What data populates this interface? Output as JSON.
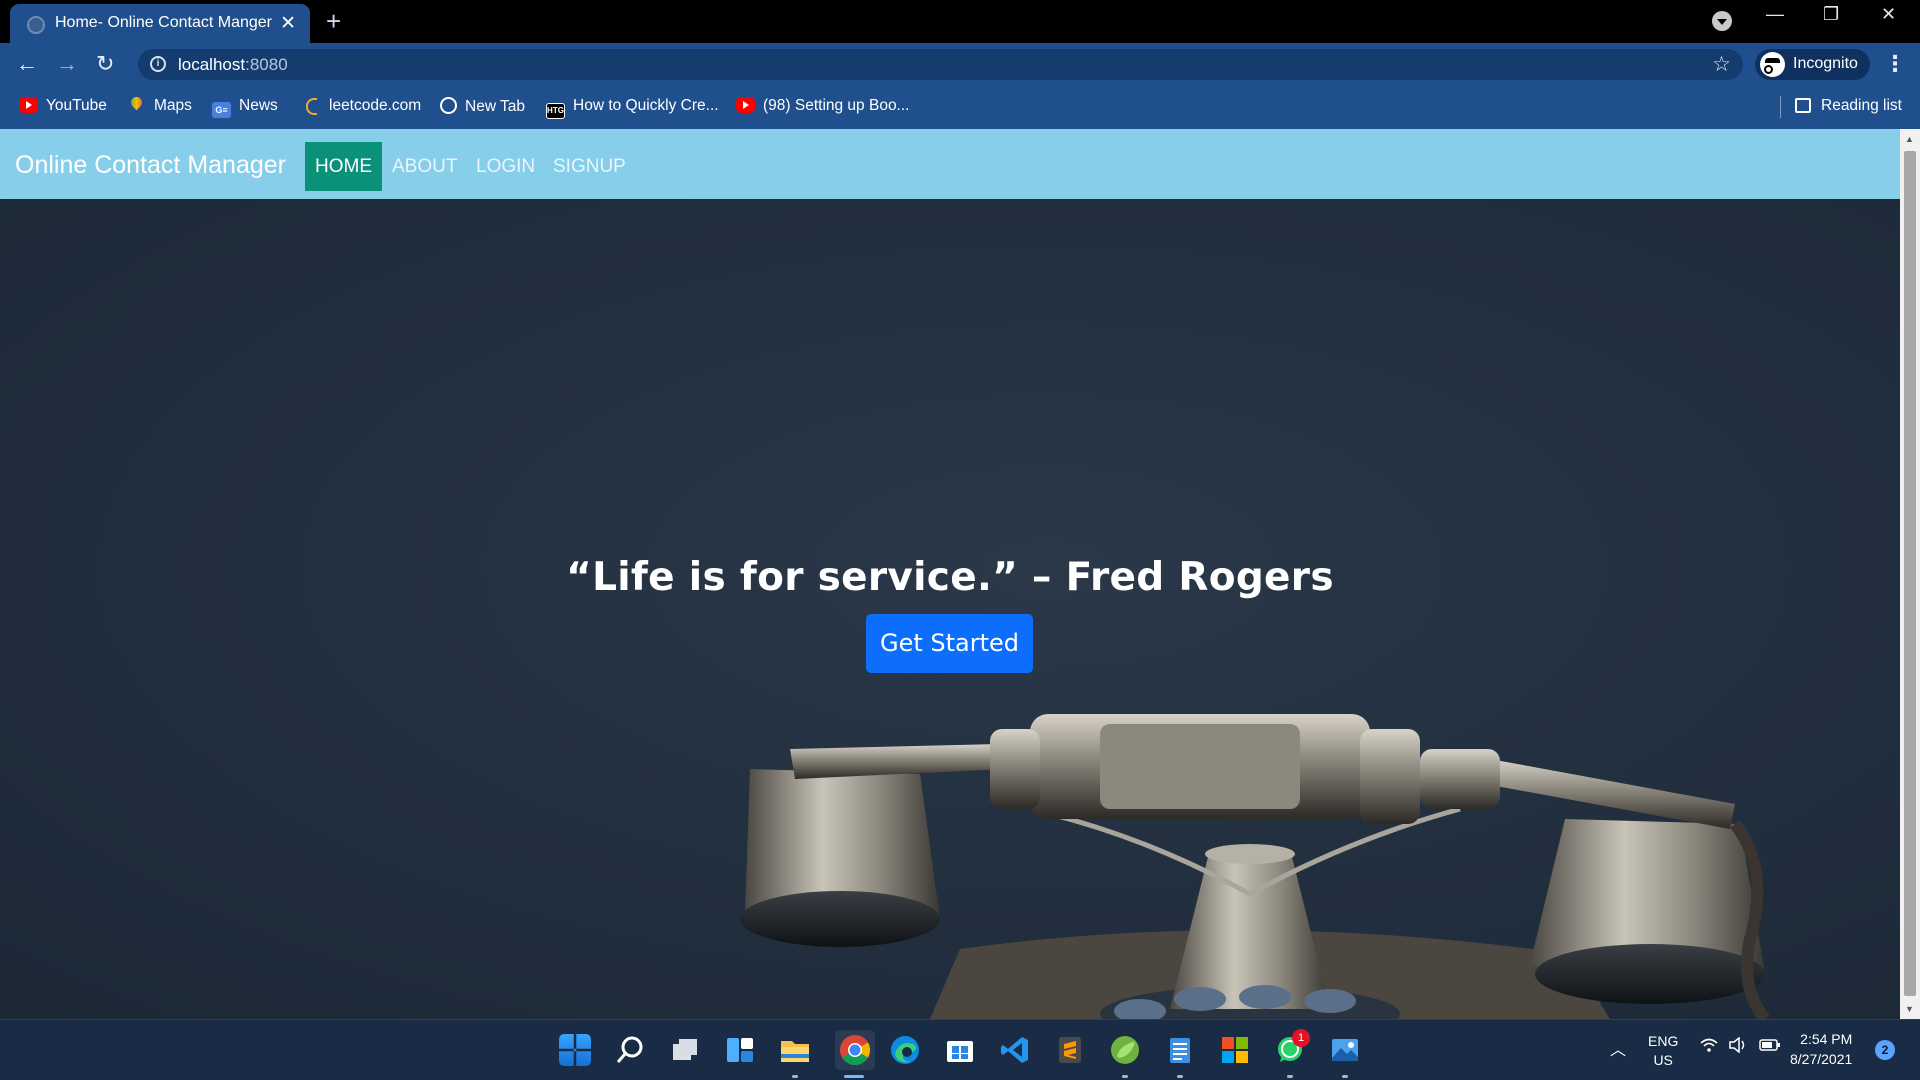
{
  "browser": {
    "tab_title": "Home- Online Contact Manger",
    "tab_close": "✕",
    "new_tab": "+",
    "url_host": "localhost",
    "url_port": ":8080",
    "incognito_label": "Incognito",
    "reading_list_label": "Reading list",
    "window_controls": {
      "minimize": "—",
      "restore": "❐",
      "close": "✕"
    },
    "bookmarks": [
      {
        "label": "YouTube",
        "icon": "youtube-icon"
      },
      {
        "label": "Maps",
        "icon": "maps-icon"
      },
      {
        "label": "News",
        "icon": "news-icon"
      },
      {
        "label": "leetcode.com",
        "icon": "leetcode-icon"
      },
      {
        "label": "New Tab",
        "icon": "globe-icon"
      },
      {
        "label": "How to Quickly Cre...",
        "icon": "htg-icon"
      },
      {
        "label": "(98) Setting up Boo...",
        "icon": "youtube-icon"
      }
    ],
    "news_icon_text": "G≡",
    "htg_icon_text": "HTG"
  },
  "page": {
    "brand": "Online Contact Manager",
    "nav": [
      {
        "label": "HOME",
        "active": true
      },
      {
        "label": "ABOUT",
        "active": false
      },
      {
        "label": "LOGIN",
        "active": false
      },
      {
        "label": "SIGNUP",
        "active": false
      }
    ],
    "hero_quote": "“Life is for service.” – Fred Rogers",
    "cta_label": "Get Started"
  },
  "taskbar": {
    "language": "ENG",
    "region": "US",
    "time": "2:54 PM",
    "date": "8/27/2021",
    "notification_count": "2",
    "whatsapp_badge": "1",
    "apps": [
      "start-icon",
      "search-icon",
      "task-view-icon",
      "widgets-icon",
      "file-explorer-icon",
      "chrome-icon",
      "edge-icon",
      "store-icon",
      "vscode-icon",
      "sublime-icon",
      "spring-icon",
      "notepad-icon",
      "office-icon",
      "whatsapp-icon",
      "photos-icon"
    ]
  },
  "colors": {
    "chrome_blue": "#1f4f8c",
    "navbar": "#87ceeb",
    "active_nav": "#0a9178",
    "cta": "#0d6efd",
    "hero_bg": "#233040"
  }
}
